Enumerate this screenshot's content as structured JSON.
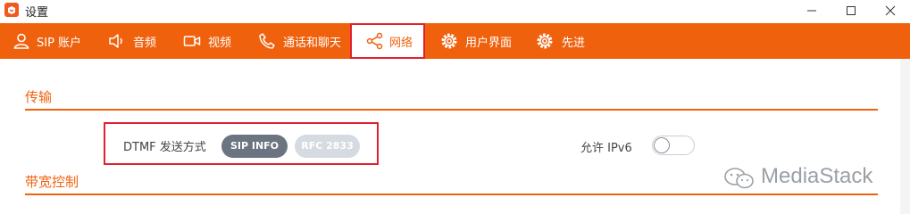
{
  "window": {
    "title": "设置"
  },
  "tabs": [
    {
      "label": "SIP 账户",
      "icon": "user-icon"
    },
    {
      "label": "音频",
      "icon": "speaker-icon"
    },
    {
      "label": "视频",
      "icon": "video-camera-icon"
    },
    {
      "label": "通话和聊天",
      "icon": "phone-icon"
    },
    {
      "label": "网络",
      "icon": "share-network-icon",
      "active": true
    },
    {
      "label": "用户界面",
      "icon": "gear-icon"
    },
    {
      "label": "先进",
      "icon": "gear-icon"
    }
  ],
  "transport": {
    "title": "传输",
    "dtmf_label": "DTMF 发送方式",
    "dtmf_options": [
      "SIP INFO",
      "RFC 2833"
    ],
    "dtmf_selected": "SIP INFO",
    "ipv6_label": "允许 IPv6",
    "ipv6_enabled": false
  },
  "bandwidth": {
    "title": "带宽控制"
  },
  "watermark": {
    "text": "MediaStack"
  },
  "colors": {
    "accent": "#f0610e",
    "highlight": "#e2202f",
    "pill_selected": "#6b7480",
    "pill_unselected": "#d6dbe1"
  }
}
